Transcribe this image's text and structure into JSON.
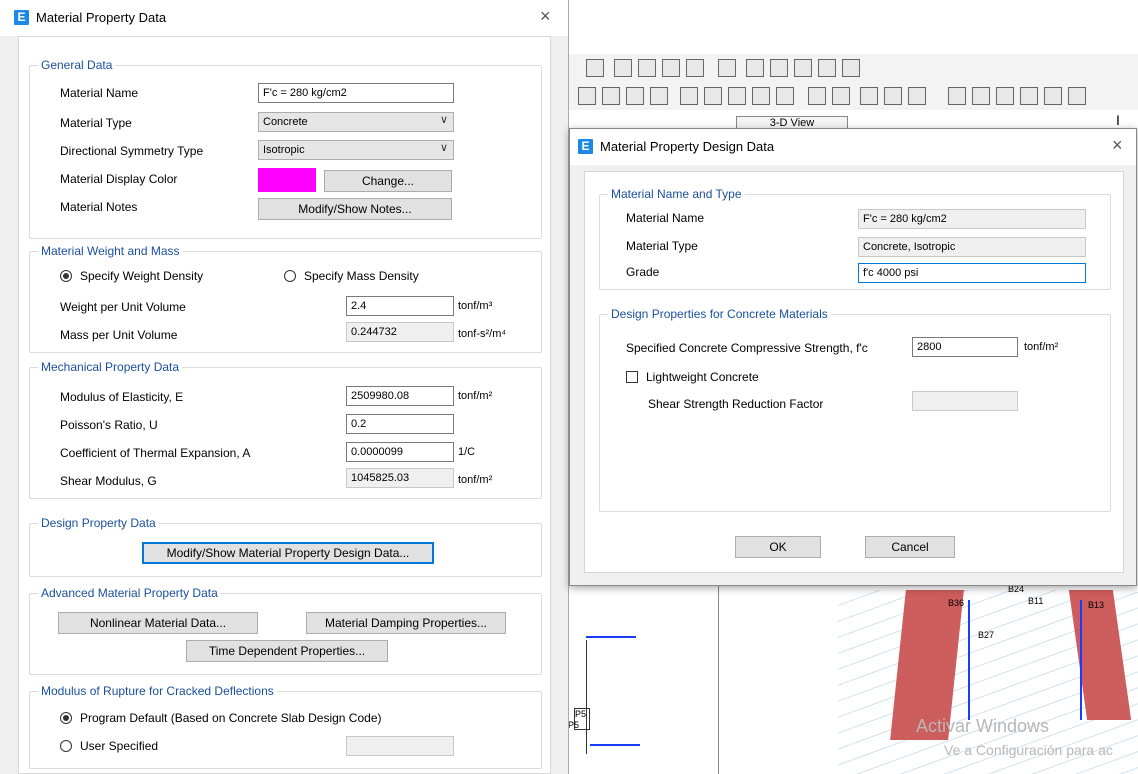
{
  "colors": {
    "accent": "#1e88e5",
    "legend": "#1a4f9c",
    "display_color": "#ff00ff",
    "focus": "#0078d7"
  },
  "dialog1": {
    "title": "Material Property Data",
    "close": "×",
    "general": {
      "legend": "General Data",
      "material_name_label": "Material Name",
      "material_name_value": "F'c = 280 kg/cm2",
      "material_type_label": "Material Type",
      "material_type_value": "Concrete",
      "symmetry_label": "Directional Symmetry Type",
      "symmetry_value": "Isotropic",
      "display_color_label": "Material Display Color",
      "change_button": "Change...",
      "notes_label": "Material Notes",
      "notes_button": "Modify/Show Notes..."
    },
    "weight": {
      "legend": "Material Weight and Mass",
      "radio_weight": "Specify Weight Density",
      "radio_mass": "Specify Mass Density",
      "weight_label": "Weight per Unit Volume",
      "weight_value": "2.4",
      "weight_unit": "tonf/m³",
      "mass_label": "Mass per Unit Volume",
      "mass_value": "0.244732",
      "mass_unit": "tonf-s²/m⁴"
    },
    "mechanical": {
      "legend": "Mechanical Property Data",
      "e_label": "Modulus of Elasticity,  E",
      "e_value": "2509980.08",
      "e_unit": "tonf/m²",
      "u_label": "Poisson's Ratio,  U",
      "u_value": "0.2",
      "a_label": "Coefficient of Thermal Expansion,  A",
      "a_value": "0.0000099",
      "a_unit": "1/C",
      "g_label": "Shear Modulus,  G",
      "g_value": "1045825.03",
      "g_unit": "tonf/m²"
    },
    "design": {
      "legend": "Design Property Data",
      "button": "Modify/Show Material Property Design Data..."
    },
    "advanced": {
      "legend": "Advanced Material Property Data",
      "nonlinear_button": "Nonlinear Material Data...",
      "damping_button": "Material Damping Properties...",
      "time_button": "Time Dependent Properties..."
    },
    "rupture": {
      "legend": "Modulus of Rupture for Cracked Deflections",
      "radio_default": "Program Default  (Based on Concrete Slab Design Code)",
      "radio_user": "User Specified",
      "user_value": ""
    }
  },
  "dialog2": {
    "title": "Material Property Design Data",
    "close": "×",
    "name_type": {
      "legend": "Material Name and Type",
      "name_label": "Material Name",
      "name_value": "F'c = 280 kg/cm2",
      "type_label": "Material Type",
      "type_value": "Concrete, Isotropic",
      "grade_label": "Grade",
      "grade_value": "f'c 4000 psi"
    },
    "concrete": {
      "legend": "Design Properties for Concrete Materials",
      "fc_label": "Specified Concrete Compressive Strength, f'c",
      "fc_value": "2800",
      "fc_unit": "tonf/m²",
      "lightweight_label": "Lightweight Concrete",
      "shear_label": "Shear Strength Reduction Factor",
      "shear_value": ""
    },
    "ok_button": "OK",
    "cancel_button": "Cancel"
  },
  "background": {
    "tab_label": "3-D View",
    "member_labels": [
      "B24",
      "B36",
      "B11",
      "B27",
      "B13",
      "P5",
      "P5"
    ],
    "watermark_line1": "Activar Windows",
    "watermark_line2": "Ve a Configuración para ac"
  }
}
